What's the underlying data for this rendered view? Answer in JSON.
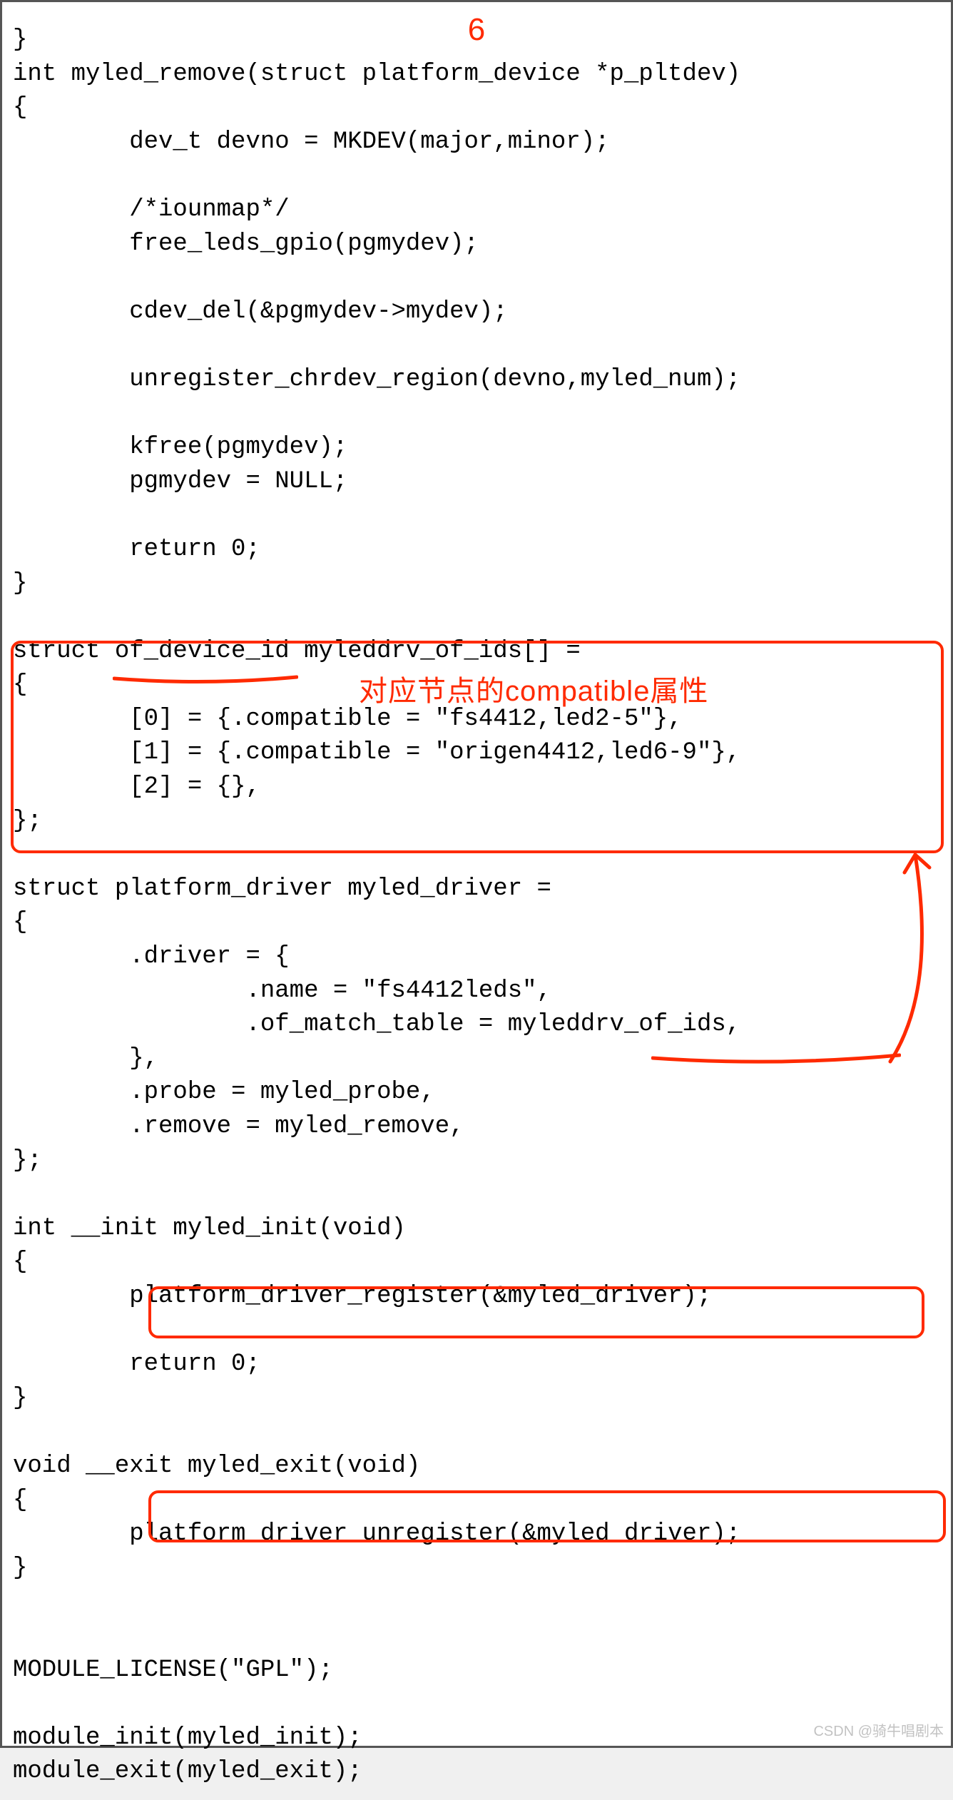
{
  "annotations": {
    "number": "6",
    "label": "对应节点的compatible属性"
  },
  "code": "}\nint myled_remove(struct platform_device *p_pltdev)\n{\n        dev_t devno = MKDEV(major,minor);\n\n        /*iounmap*/\n        free_leds_gpio(pgmydev);\n\n        cdev_del(&pgmydev->mydev);\n\n        unregister_chrdev_region(devno,myled_num);\n\n        kfree(pgmydev);\n        pgmydev = NULL;\n\n        return 0;\n}\n\nstruct of_device_id myleddrv_of_ids[] =\n{\n        [0] = {.compatible = \"fs4412,led2-5\"},\n        [1] = {.compatible = \"origen4412,led6-9\"},\n        [2] = {},\n};\n\nstruct platform_driver myled_driver =\n{\n        .driver = {\n                .name = \"fs4412leds\",\n                .of_match_table = myleddrv_of_ids,\n        },\n        .probe = myled_probe,\n        .remove = myled_remove,\n};\n\nint __init myled_init(void)\n{\n        platform_driver_register(&myled_driver);\n\n        return 0;\n}\n\nvoid __exit myled_exit(void)\n{\n        platform_driver_unregister(&myled_driver);\n}\n\n\nMODULE_LICENSE(\"GPL\");\n\nmodule_init(myled_init);\nmodule_exit(myled_exit);",
  "watermark": "CSDN @骑牛唱剧本"
}
